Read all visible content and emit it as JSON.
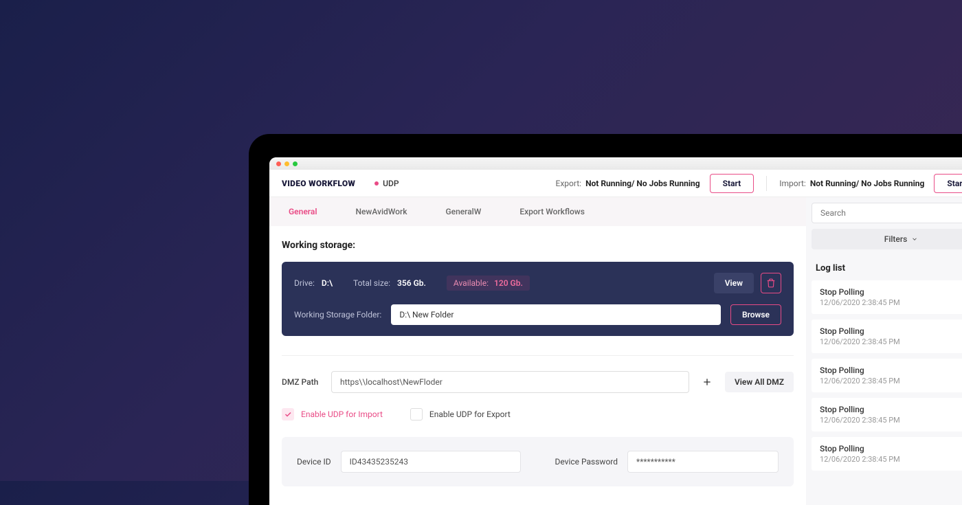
{
  "app": {
    "title": "VIDEO WORKFLOW",
    "protocol": "UDP"
  },
  "header": {
    "export_label": "Export:",
    "export_status": "Not Running/ No Jobs Running",
    "start_button": "Start",
    "import_label": "Import:",
    "import_status": "Not Running/ No Jobs Running",
    "import_button": "Start"
  },
  "tabs": [
    "General",
    "NewAvidWork",
    "GeneralW",
    "Export Workflows"
  ],
  "storage": {
    "section_title": "Working storage:",
    "drive_label": "Drive:",
    "drive_value": "D:\\",
    "total_label": "Total size:",
    "total_value": "356 Gb.",
    "avail_label": "Available:",
    "avail_value": "120 Gb.",
    "view_button": "View",
    "folder_label": "Working Storage Folder:",
    "folder_value": "D:\\ New Folder",
    "browse_button": "Browse"
  },
  "dmz": {
    "label": "DMZ Path",
    "value": "https\\\\localhost\\NewFloder",
    "view_all_button": "View All DMZ"
  },
  "checks": {
    "import_label": "Enable UDP for Import",
    "export_label": "Enable UDP for Export"
  },
  "device": {
    "id_label": "Device ID",
    "id_value": "ID43435235243",
    "pw_label": "Device Password",
    "pw_value": "***********"
  },
  "side": {
    "search_placeholder": "Search",
    "filters_label": "Filters",
    "loglist_title": "Log list",
    "logs": [
      {
        "title": "Stop Polling",
        "time": "12/06/2020 2:38:45 PM"
      },
      {
        "title": "Stop Polling",
        "time": "12/06/2020 2:38:45 PM"
      },
      {
        "title": "Stop Polling",
        "time": "12/06/2020 2:38:45 PM"
      },
      {
        "title": "Stop Polling",
        "time": "12/06/2020 2:38:45 PM"
      },
      {
        "title": "Stop Polling",
        "time": "12/06/2020 2:38:45 PM"
      }
    ]
  }
}
